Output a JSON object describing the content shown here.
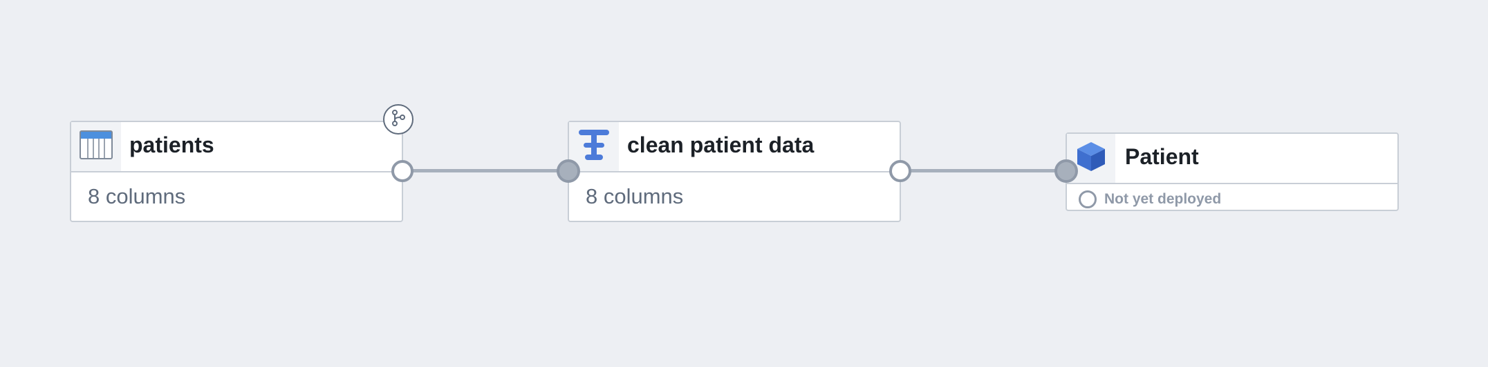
{
  "pipeline": {
    "nodes": [
      {
        "type": "dataset",
        "icon": "table-icon",
        "title": "patients",
        "subtitle": "8 columns"
      },
      {
        "type": "transform",
        "icon": "transform-icon",
        "title": "clean patient data",
        "subtitle": "8 columns"
      },
      {
        "type": "object",
        "icon": "cube-icon",
        "title": "Patient",
        "status": "Not yet deployed"
      }
    ],
    "branch_icon": "branch-icon"
  },
  "colors": {
    "background": "#edeff3",
    "node_border": "#c8ced6",
    "edge": "#a7b0bc",
    "port": "#8f99a8",
    "accent_blue": "#4c7bd9",
    "title_text": "#1c2127",
    "sub_text": "#5f6b7c"
  }
}
